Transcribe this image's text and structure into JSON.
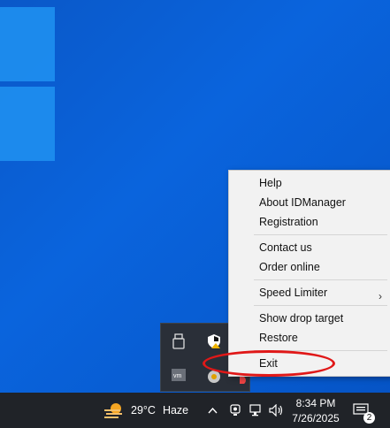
{
  "context_menu": {
    "items": [
      {
        "label": "Help"
      },
      {
        "label": "About IDManager"
      },
      {
        "label": "Registration"
      },
      {
        "label": "Contact us"
      },
      {
        "label": "Order online"
      },
      {
        "label": "Speed Limiter",
        "submenu": true
      },
      {
        "label": "Show drop target"
      },
      {
        "label": "Restore"
      },
      {
        "label": "Exit",
        "highlighted_by_annotation": true
      }
    ],
    "submenu_chevron": "›"
  },
  "tray_overflow": {
    "icons": [
      "usb-drive-icon",
      "defender-shield-icon",
      "vmware-icon",
      "idm-icon",
      "colored-app-icon"
    ]
  },
  "taskbar": {
    "weather": {
      "temperature": "29°C",
      "condition": "Haze",
      "icon": "haze-weather-icon"
    },
    "tray_expand_glyph": "^",
    "time": "8:34 PM",
    "date": "7/26/2025",
    "notification_count": "2"
  },
  "annotation": {
    "color": "#e01818",
    "shape": "oval"
  }
}
